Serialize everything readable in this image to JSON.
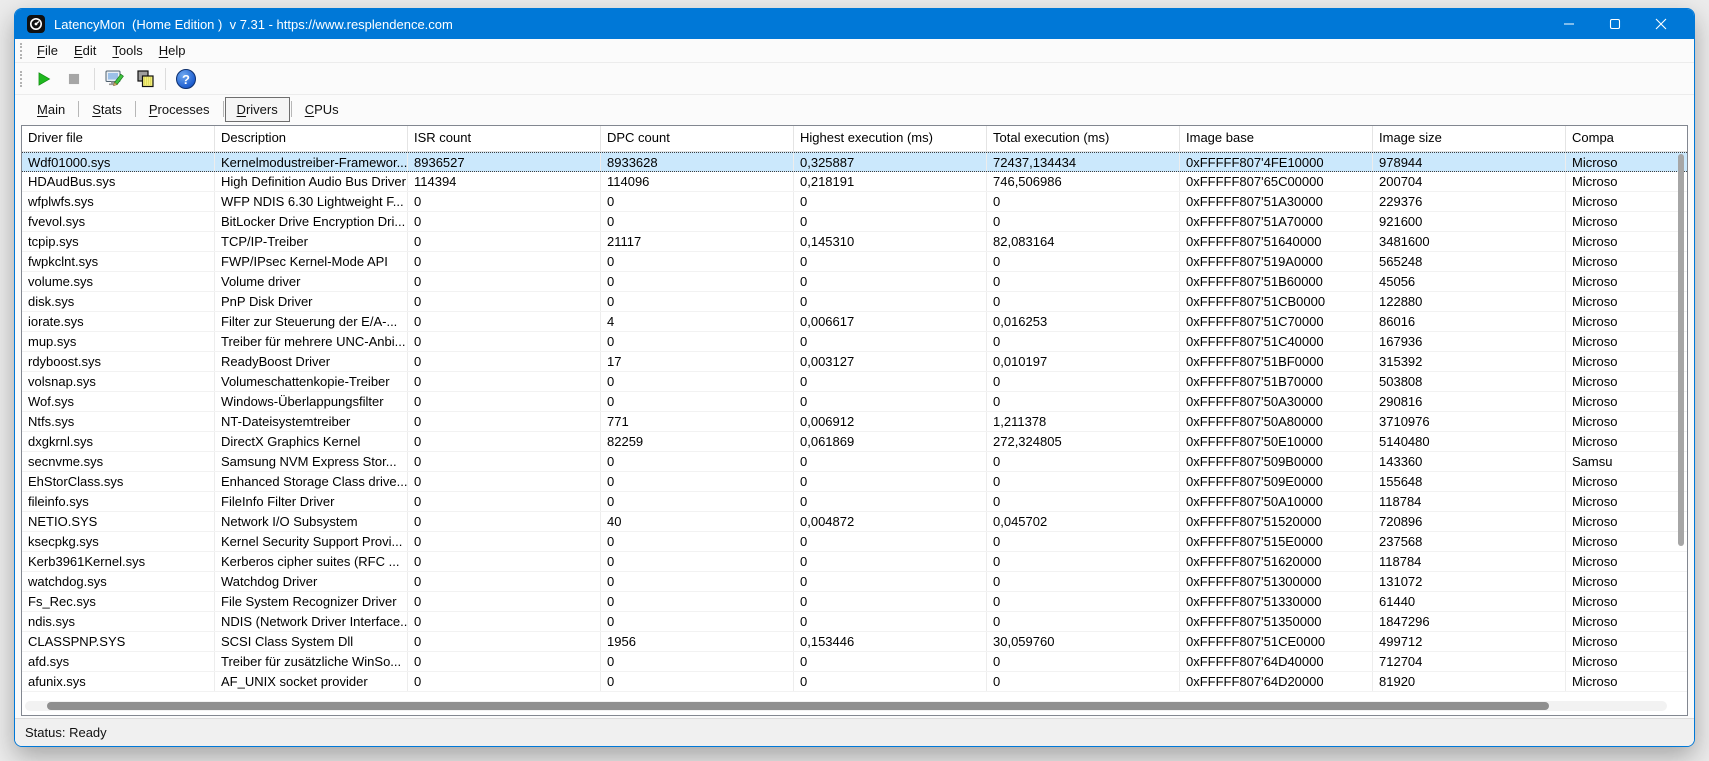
{
  "window": {
    "title": "LatencyMon  (Home Edition )  v 7.31 - https://www.resplendence.com",
    "icons": {
      "app": "latencymon-logo-icon",
      "minimize": "minimize-icon",
      "maximize": "maximize-icon",
      "close": "close-icon"
    }
  },
  "menu": {
    "items": [
      "File",
      "Edit",
      "Tools",
      "Help"
    ]
  },
  "toolbar": {
    "icons": [
      "play-icon",
      "stop-icon",
      "system-report-icon",
      "windows-layers-icon",
      "help-icon"
    ]
  },
  "tabs": {
    "items": [
      "Main",
      "Stats",
      "Processes",
      "Drivers",
      "CPUs"
    ],
    "selected": "Drivers"
  },
  "table": {
    "columns": [
      "Driver file",
      "Description",
      "ISR count",
      "DPC count",
      "Highest execution (ms)",
      "Total execution (ms)",
      "Image base",
      "Image size",
      "Compa"
    ],
    "selected_row_index": 0,
    "rows": [
      [
        "Wdf01000.sys",
        "Kernelmodustreiber-Framewor...",
        "8936527",
        "8933628",
        "0,325887",
        "72437,134434",
        "0xFFFFF807'4FE10000",
        "978944",
        "Microso"
      ],
      [
        "HDAudBus.sys",
        "High Definition Audio Bus Driver",
        "114394",
        "114096",
        "0,218191",
        "746,506986",
        "0xFFFFF807'65C00000",
        "200704",
        "Microso"
      ],
      [
        "wfplwfs.sys",
        "WFP NDIS 6.30 Lightweight F...",
        "0",
        "0",
        "0",
        "0",
        "0xFFFFF807'51A30000",
        "229376",
        "Microso"
      ],
      [
        "fvevol.sys",
        "BitLocker Drive Encryption Dri...",
        "0",
        "0",
        "0",
        "0",
        "0xFFFFF807'51A70000",
        "921600",
        "Microso"
      ],
      [
        "tcpip.sys",
        "TCP/IP-Treiber",
        "0",
        "21117",
        "0,145310",
        "82,083164",
        "0xFFFFF807'51640000",
        "3481600",
        "Microso"
      ],
      [
        "fwpkclnt.sys",
        "FWP/IPsec Kernel-Mode API",
        "0",
        "0",
        "0",
        "0",
        "0xFFFFF807'519A0000",
        "565248",
        "Microso"
      ],
      [
        "volume.sys",
        "Volume driver",
        "0",
        "0",
        "0",
        "0",
        "0xFFFFF807'51B60000",
        "45056",
        "Microso"
      ],
      [
        "disk.sys",
        "PnP Disk Driver",
        "0",
        "0",
        "0",
        "0",
        "0xFFFFF807'51CB0000",
        "122880",
        "Microso"
      ],
      [
        "iorate.sys",
        "Filter zur Steuerung der E/A-...",
        "0",
        "4",
        "0,006617",
        "0,016253",
        "0xFFFFF807'51C70000",
        "86016",
        "Microso"
      ],
      [
        "mup.sys",
        "Treiber für mehrere UNC-Anbi...",
        "0",
        "0",
        "0",
        "0",
        "0xFFFFF807'51C40000",
        "167936",
        "Microso"
      ],
      [
        "rdyboost.sys",
        "ReadyBoost Driver",
        "0",
        "17",
        "0,003127",
        "0,010197",
        "0xFFFFF807'51BF0000",
        "315392",
        "Microso"
      ],
      [
        "volsnap.sys",
        "Volumeschattenkopie-Treiber",
        "0",
        "0",
        "0",
        "0",
        "0xFFFFF807'51B70000",
        "503808",
        "Microso"
      ],
      [
        "Wof.sys",
        "Windows-Überlappungsfilter",
        "0",
        "0",
        "0",
        "0",
        "0xFFFFF807'50A30000",
        "290816",
        "Microso"
      ],
      [
        "Ntfs.sys",
        "NT-Dateisystemtreiber",
        "0",
        "771",
        "0,006912",
        "1,211378",
        "0xFFFFF807'50A80000",
        "3710976",
        "Microso"
      ],
      [
        "dxgkrnl.sys",
        "DirectX Graphics Kernel",
        "0",
        "82259",
        "0,061869",
        "272,324805",
        "0xFFFFF807'50E10000",
        "5140480",
        "Microso"
      ],
      [
        "secnvme.sys",
        "Samsung NVM Express Stor...",
        "0",
        "0",
        "0",
        "0",
        "0xFFFFF807'509B0000",
        "143360",
        "Samsu"
      ],
      [
        "EhStorClass.sys",
        "Enhanced Storage Class drive...",
        "0",
        "0",
        "0",
        "0",
        "0xFFFFF807'509E0000",
        "155648",
        "Microso"
      ],
      [
        "fileinfo.sys",
        "FileInfo Filter Driver",
        "0",
        "0",
        "0",
        "0",
        "0xFFFFF807'50A10000",
        "118784",
        "Microso"
      ],
      [
        "NETIO.SYS",
        "Network I/O Subsystem",
        "0",
        "40",
        "0,004872",
        "0,045702",
        "0xFFFFF807'51520000",
        "720896",
        "Microso"
      ],
      [
        "ksecpkg.sys",
        "Kernel Security Support Provi...",
        "0",
        "0",
        "0",
        "0",
        "0xFFFFF807'515E0000",
        "237568",
        "Microso"
      ],
      [
        "Kerb3961Kernel.sys",
        "Kerberos cipher suites (RFC ...",
        "0",
        "0",
        "0",
        "0",
        "0xFFFFF807'51620000",
        "118784",
        "Microso"
      ],
      [
        "watchdog.sys",
        "Watchdog Driver",
        "0",
        "0",
        "0",
        "0",
        "0xFFFFF807'51300000",
        "131072",
        "Microso"
      ],
      [
        "Fs_Rec.sys",
        "File System Recognizer Driver",
        "0",
        "0",
        "0",
        "0",
        "0xFFFFF807'51330000",
        "61440",
        "Microso"
      ],
      [
        "ndis.sys",
        "NDIS (Network Driver Interface...",
        "0",
        "0",
        "0",
        "0",
        "0xFFFFF807'51350000",
        "1847296",
        "Microso"
      ],
      [
        "CLASSPNP.SYS",
        "SCSI Class System Dll",
        "0",
        "1956",
        "0,153446",
        "30,059760",
        "0xFFFFF807'51CE0000",
        "499712",
        "Microso"
      ],
      [
        "afd.sys",
        "Treiber für zusätzliche WinSo...",
        "0",
        "0",
        "0",
        "0",
        "0xFFFFF807'64D40000",
        "712704",
        "Microso"
      ],
      [
        "afunix.sys",
        "AF_UNIX socket provider",
        "0",
        "0",
        "0",
        "0",
        "0xFFFFF807'64D20000",
        "81920",
        "Microso"
      ]
    ]
  },
  "statusbar": {
    "text": "Status: Ready"
  },
  "colors": {
    "titlebar": "#0078d7",
    "selection_bg": "#cbe8fc",
    "window_border": "#0078d7",
    "play_green": "#1fb81f",
    "stop_gray": "#a6a6a6"
  }
}
